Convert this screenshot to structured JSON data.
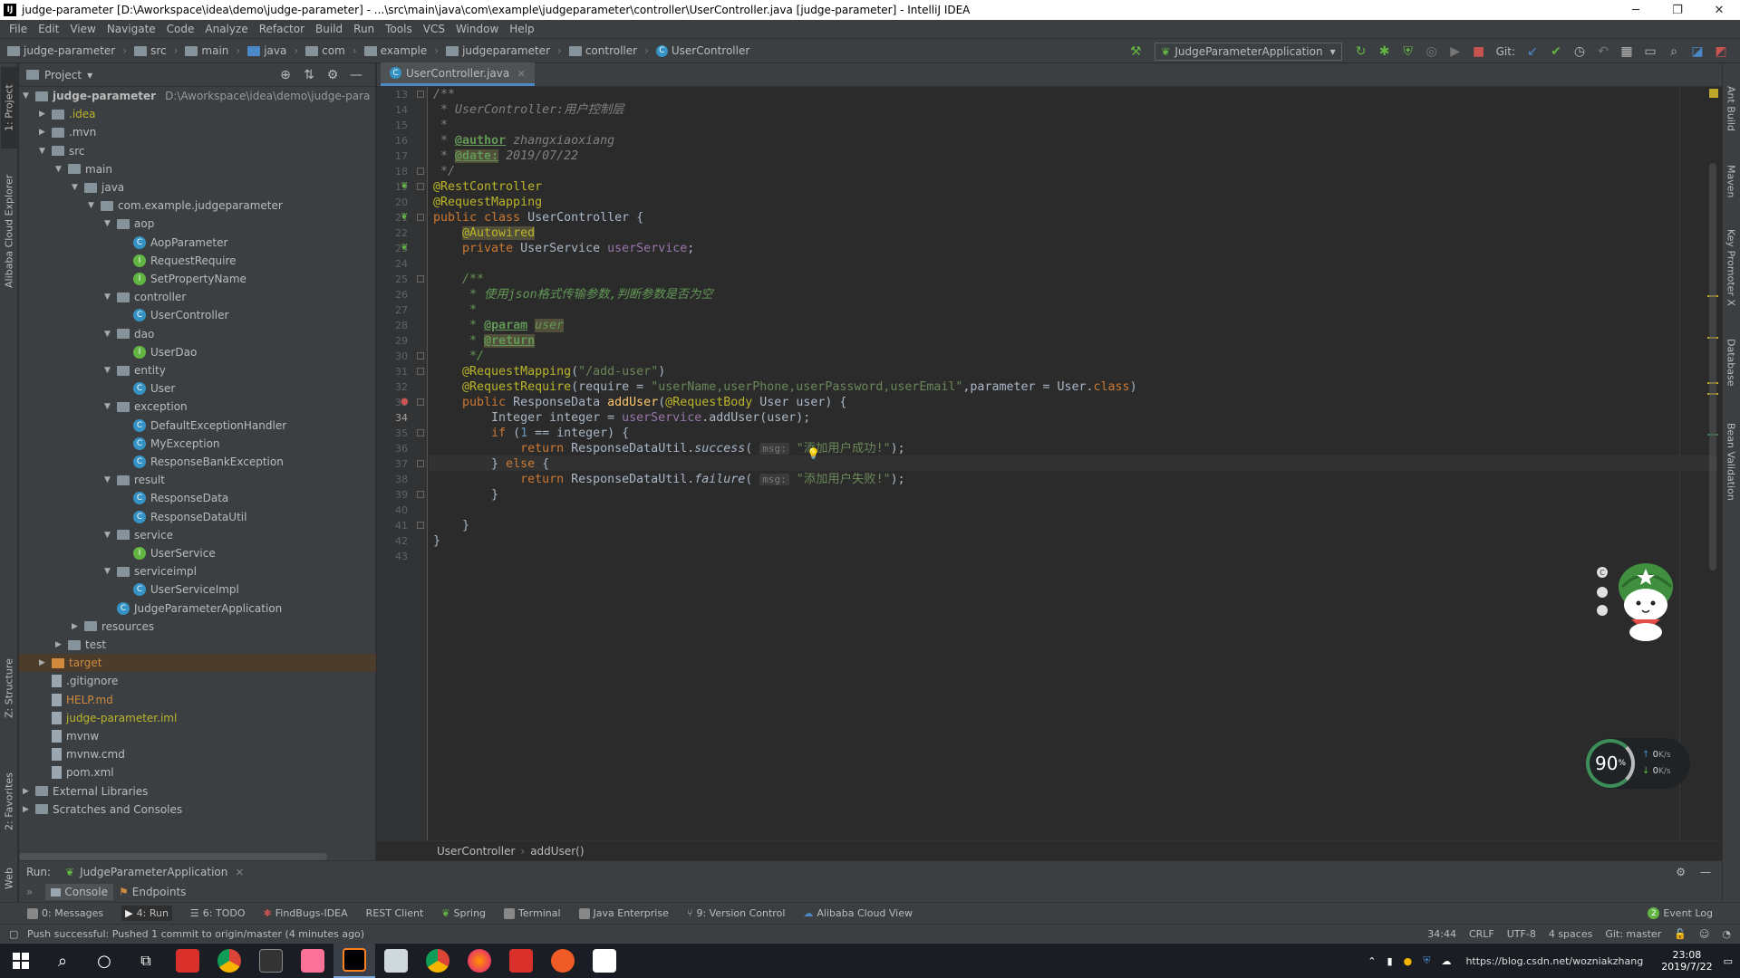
{
  "window": {
    "title": "judge-parameter [D:\\Aworkspace\\idea\\demo\\judge-parameter] - ...\\src\\main\\java\\com\\example\\judgeparameter\\controller\\UserController.java [judge-parameter] - IntelliJ IDEA",
    "app_icon": "IJ",
    "minimize": "─",
    "maximize": "❐",
    "close": "✕"
  },
  "menu": [
    "File",
    "Edit",
    "View",
    "Navigate",
    "Code",
    "Analyze",
    "Refactor",
    "Build",
    "Run",
    "Tools",
    "VCS",
    "Window",
    "Help"
  ],
  "breadcrumbs": [
    "judge-parameter",
    "src",
    "main",
    "java",
    "com",
    "example",
    "judgeparameter",
    "controller",
    "UserController"
  ],
  "toolbar": {
    "run_config": "JudgeParameterApplication",
    "git_label": "Git:"
  },
  "left_strip": {
    "project": "1: Project",
    "cloud": "Alibaba Cloud Explorer",
    "structure": "Z: Structure",
    "favorites": "2: Favorites",
    "web": "Web"
  },
  "right_strip": {
    "ant": "Ant Build",
    "maven": "Maven",
    "key": "Key Promoter X",
    "database": "Database",
    "bean": "Bean Validation"
  },
  "project_panel": {
    "title": "Project",
    "root_path": "D:\\Aworkspace\\idea\\demo\\judge-para"
  },
  "tree": [
    {
      "label": "judge-parameter",
      "type": "root",
      "depth": 0,
      "arrow": "▼",
      "bold": true
    },
    {
      "label": ".idea",
      "type": "folder",
      "depth": 1,
      "arrow": "▶",
      "color": "#bbb529"
    },
    {
      "label": ".mvn",
      "type": "folder",
      "depth": 1,
      "arrow": "▶"
    },
    {
      "label": "src",
      "type": "folder",
      "depth": 1,
      "arrow": "▼"
    },
    {
      "label": "main",
      "type": "folder",
      "depth": 2,
      "arrow": "▼"
    },
    {
      "label": "java",
      "type": "folder",
      "depth": 3,
      "arrow": "▼"
    },
    {
      "label": "com.example.judgeparameter",
      "type": "pkg",
      "depth": 4,
      "arrow": "▼"
    },
    {
      "label": "aop",
      "type": "pkg",
      "depth": 5,
      "arrow": "▼"
    },
    {
      "label": "AopParameter",
      "type": "class",
      "depth": 6,
      "arrow": ""
    },
    {
      "label": "RequestRequire",
      "type": "iface",
      "depth": 6,
      "arrow": ""
    },
    {
      "label": "SetPropertyName",
      "type": "iface",
      "depth": 6,
      "arrow": ""
    },
    {
      "label": "controller",
      "type": "pkg",
      "depth": 5,
      "arrow": "▼"
    },
    {
      "label": "UserController",
      "type": "class",
      "depth": 6,
      "arrow": ""
    },
    {
      "label": "dao",
      "type": "pkg",
      "depth": 5,
      "arrow": "▼"
    },
    {
      "label": "UserDao",
      "type": "iface",
      "depth": 6,
      "arrow": ""
    },
    {
      "label": "entity",
      "type": "pkg",
      "depth": 5,
      "arrow": "▼"
    },
    {
      "label": "User",
      "type": "class",
      "depth": 6,
      "arrow": ""
    },
    {
      "label": "exception",
      "type": "pkg",
      "depth": 5,
      "arrow": "▼"
    },
    {
      "label": "DefaultExceptionHandler",
      "type": "class",
      "depth": 6,
      "arrow": ""
    },
    {
      "label": "MyException",
      "type": "class",
      "depth": 6,
      "arrow": ""
    },
    {
      "label": "ResponseBankException",
      "type": "class",
      "depth": 6,
      "arrow": ""
    },
    {
      "label": "result",
      "type": "pkg",
      "depth": 5,
      "arrow": "▼"
    },
    {
      "label": "ResponseData",
      "type": "class",
      "depth": 6,
      "arrow": ""
    },
    {
      "label": "ResponseDataUtil",
      "type": "class",
      "depth": 6,
      "arrow": ""
    },
    {
      "label": "service",
      "type": "pkg",
      "depth": 5,
      "arrow": "▼"
    },
    {
      "label": "UserService",
      "type": "iface",
      "depth": 6,
      "arrow": ""
    },
    {
      "label": "serviceimpl",
      "type": "pkg",
      "depth": 5,
      "arrow": "▼"
    },
    {
      "label": "UserServiceImpl",
      "type": "class",
      "depth": 6,
      "arrow": ""
    },
    {
      "label": "JudgeParameterApplication",
      "type": "class",
      "depth": 5,
      "arrow": ""
    },
    {
      "label": "resources",
      "type": "folder",
      "depth": 3,
      "arrow": "▶"
    },
    {
      "label": "test",
      "type": "folder",
      "depth": 2,
      "arrow": "▶"
    },
    {
      "label": "target",
      "type": "orange",
      "depth": 1,
      "arrow": "▶",
      "color": "#d08b3e",
      "highlight": true
    },
    {
      "label": ".gitignore",
      "type": "file",
      "depth": 1,
      "arrow": ""
    },
    {
      "label": "HELP.md",
      "type": "file",
      "depth": 1,
      "arrow": "",
      "color": "#d08b3e"
    },
    {
      "label": "judge-parameter.iml",
      "type": "file",
      "depth": 1,
      "arrow": "",
      "color": "#bbb529"
    },
    {
      "label": "mvnw",
      "type": "file",
      "depth": 1,
      "arrow": ""
    },
    {
      "label": "mvnw.cmd",
      "type": "file",
      "depth": 1,
      "arrow": ""
    },
    {
      "label": "pom.xml",
      "type": "file",
      "depth": 1,
      "arrow": ""
    },
    {
      "label": "External Libraries",
      "type": "lib",
      "depth": 0,
      "arrow": "▶"
    },
    {
      "label": "Scratches and Consoles",
      "type": "lib",
      "depth": 0,
      "arrow": "▶"
    }
  ],
  "editor": {
    "tab": "UserController.java",
    "current_line": "34",
    "breadcrumb": [
      "UserController",
      "addUser()"
    ]
  },
  "code_lines": [
    {
      "n": "13",
      "html": "<span class='cmtg'>/**</span>"
    },
    {
      "n": "14",
      "html": "<span class='cmtg'> * UserController:用户控制层</span>"
    },
    {
      "n": "15",
      "html": "<span class='cmtg'> *</span>"
    },
    {
      "n": "16",
      "html": "<span class='cmtg'> * </span><span class='tag'>@author</span><span class='cmtg'> zhangxiaoxiang</span>"
    },
    {
      "n": "17",
      "html": "<span class='cmtg'> * </span><span class='tag warnbg'>@date:</span><span class='cmtg'> 2019/07/22</span>"
    },
    {
      "n": "18",
      "html": "<span class='cmtg'> */</span>"
    },
    {
      "n": "19",
      "html": "<span class='ann'>@RestController</span>"
    },
    {
      "n": "20",
      "html": "<span class='ann'>@RequestMapping</span>"
    },
    {
      "n": "21",
      "html": "<span class='kw'>public class </span>UserController {"
    },
    {
      "n": "22",
      "html": "    <span class='ann warnbg'>@Autowired</span>"
    },
    {
      "n": "23",
      "html": "    <span class='kw'>private </span>UserService <span class='fld'>userService</span>;"
    },
    {
      "n": "24",
      "html": ""
    },
    {
      "n": "25",
      "html": "    <span class='cmt'>/**</span>"
    },
    {
      "n": "26",
      "html": "    <span class='cmt'> * 使用json格式传输参数,判断参数是否为空</span>"
    },
    {
      "n": "27",
      "html": "    <span class='cmt'> *</span>"
    },
    {
      "n": "28",
      "html": "    <span class='cmt'> * </span><span class='tag'>@param</span><span class='cmt'> </span><span class='cmt warnbg'>user</span>"
    },
    {
      "n": "29",
      "html": "    <span class='cmt'> * </span><span class='tag warnbg'>@return</span>"
    },
    {
      "n": "30",
      "html": "    <span class='cmt'> */</span>"
    },
    {
      "n": "31",
      "html": "    <span class='ann'>@RequestMapping</span>(<span class='str'>\"/add-user\"</span>)"
    },
    {
      "n": "32",
      "html": "    <span class='ann'>@RequestRequire</span>(require = <span class='str'>\"userName,userPhone,userPassword,userEmail\"</span>,parameter = User.<span class='kw'>class</span>)"
    },
    {
      "n": "33",
      "html": "    <span class='kw'>public </span>ResponseData <span class='fn'>addUser</span>(<span class='ann'>@RequestBody </span>User user) {"
    },
    {
      "n": "34",
      "html": "        Integer integer = <span class='fld'>userService</span>.addUser(user);"
    },
    {
      "n": "35",
      "html": "        <span class='kw'>if </span>(<span style='color:#6897bb'>1</span> == integer) {"
    },
    {
      "n": "36",
      "html": "            <span class='kw'>return </span>ResponseDataUtil.<span class='it'>success</span>( <span class='hint'>msg:</span> <span class='str'>\"添加用户成功!\"</span>);"
    },
    {
      "n": "37",
      "html": "        } <span class='kw'>else </span>{"
    },
    {
      "n": "38",
      "html": "            <span class='kw'>return </span>ResponseDataUtil.<span class='it'>failure</span>( <span class='hint'>msg:</span> <span class='str'>\"添加用户失败!\"</span>);"
    },
    {
      "n": "39",
      "html": "        }"
    },
    {
      "n": "40",
      "html": ""
    },
    {
      "n": "41",
      "html": "    }"
    },
    {
      "n": "42",
      "html": "}"
    },
    {
      "n": "43",
      "html": ""
    }
  ],
  "run": {
    "label": "Run:",
    "config": "JudgeParameterApplication",
    "console": "Console",
    "endpoints": "Endpoints"
  },
  "tool_windows": [
    "0: Messages",
    "4: Run",
    "6: TODO",
    "FindBugs-IDEA",
    "REST Client",
    "Spring",
    "Terminal",
    "Java Enterprise",
    "9: Version Control",
    "Alibaba Cloud View"
  ],
  "event_log": "Event Log",
  "event_count": "2",
  "status": {
    "message": "Push successful: Pushed 1 commit to origin/master (4 minutes ago)",
    "position": "34:44",
    "line_sep": "CRLF",
    "encoding": "UTF-8",
    "indent": "4 spaces",
    "git": "Git: master"
  },
  "gauge": {
    "percent": "90",
    "unit": "%",
    "up": "0",
    "down": "0",
    "speed_unit": "K/s"
  },
  "clock": {
    "time": "23:08",
    "date": "2019/7/22"
  },
  "watermark": "https://blog.csdn.net/wozniakzhang"
}
